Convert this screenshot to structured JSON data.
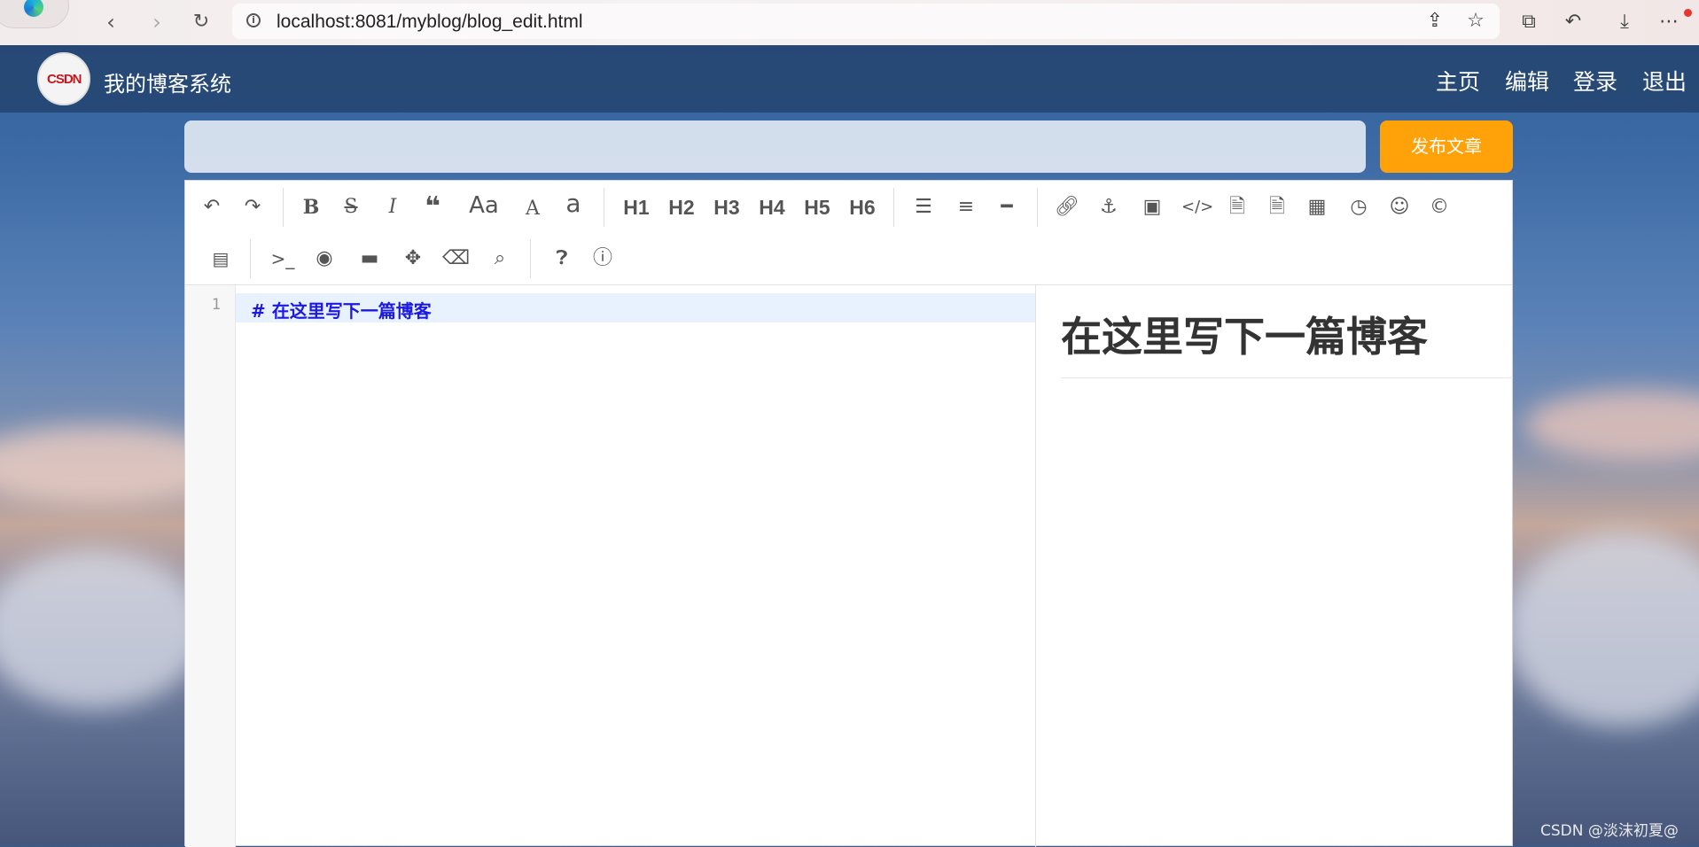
{
  "browser": {
    "url": "localhost:8081/myblog/blog_edit.html"
  },
  "site": {
    "logo_text": "CSDN",
    "title": "我的博客系统",
    "nav": [
      "主页",
      "编辑",
      "登录",
      "退出"
    ]
  },
  "editor": {
    "title_placeholder": "",
    "publish_label": "发布文章",
    "toolbar_headings": [
      "H1",
      "H2",
      "H3",
      "H4",
      "H5",
      "H6"
    ],
    "toolbar_font_labels": [
      "Aa",
      "A",
      "a"
    ],
    "line_number": "1",
    "markdown_line": "#  在这里写下一篇博客",
    "preview_heading": "在这里写下一篇博客"
  },
  "watermark": "CSDN @淡沫初夏@",
  "colors": {
    "accent": "#ffa20a",
    "nav_bg": "#264673",
    "markdown_heading": "#1c19e3"
  }
}
